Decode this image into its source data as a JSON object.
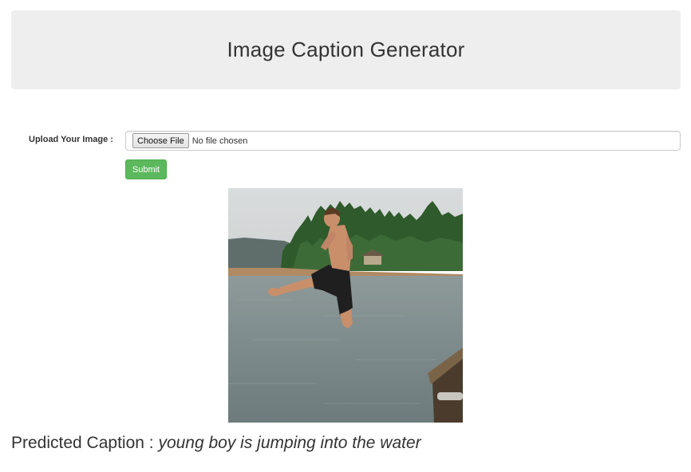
{
  "header": {
    "title": "Image Caption Generator"
  },
  "upload": {
    "label": "Upload Your Image :",
    "choose_button": "Choose File",
    "file_status": "No file chosen"
  },
  "actions": {
    "submit_label": "Submit"
  },
  "result": {
    "caption_label": "Predicted Caption : ",
    "caption_value": "young boy is jumping into the water"
  },
  "colors": {
    "submit_bg": "#5cb85c",
    "header_bg": "#eeeeee"
  }
}
